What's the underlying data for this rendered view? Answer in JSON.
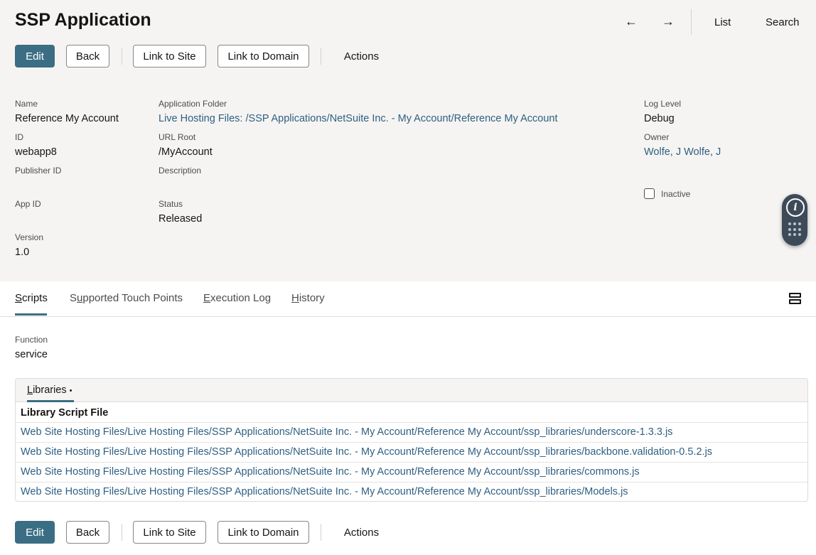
{
  "page": {
    "title": "SSP Application",
    "nav": {
      "back_arrow": "←",
      "forward_arrow": "→",
      "list": "List",
      "search": "Search"
    }
  },
  "toolbar": {
    "edit": "Edit",
    "back": "Back",
    "link_to_site": "Link to Site",
    "link_to_domain": "Link to Domain",
    "actions": "Actions"
  },
  "fields": {
    "name": {
      "label": "Name",
      "value": "Reference My Account"
    },
    "id": {
      "label": "ID",
      "value": "webapp8"
    },
    "publisher_id": {
      "label": "Publisher ID",
      "value": ""
    },
    "app_id": {
      "label": "App ID",
      "value": ""
    },
    "version": {
      "label": "Version",
      "value": "1.0"
    },
    "application_folder": {
      "label": "Application Folder",
      "value": "Live Hosting Files: /SSP Applications/NetSuite Inc. - My Account/Reference My Account"
    },
    "url_root": {
      "label": "URL Root",
      "value": "/MyAccount"
    },
    "description": {
      "label": "Description",
      "value": ""
    },
    "status": {
      "label": "Status",
      "value": "Released"
    },
    "log_level": {
      "label": "Log Level",
      "value": "Debug"
    },
    "owner": {
      "label": "Owner",
      "value": "Wolfe, J Wolfe, J"
    },
    "inactive": {
      "label": "Inactive",
      "checked": false
    }
  },
  "float_panel": {
    "info_icon": "info-icon",
    "glyph": "i",
    "apps_icon": "grid-dots-icon"
  },
  "tabs": [
    {
      "first": "S",
      "rest": "cripts",
      "active": true
    },
    {
      "first": "S",
      "rest": "upported Touch Points",
      "active": false,
      "prefix": "",
      "underline_index": 1
    },
    {
      "first": "E",
      "rest": "xecution Log",
      "active": false
    },
    {
      "first": "H",
      "rest": "istory",
      "active": false
    }
  ],
  "scripts_tab": {
    "function_label": "Function",
    "function_value": "service",
    "sublist": {
      "tab_first": "L",
      "tab_rest": "ibraries",
      "tab_marker": "•",
      "column_header": "Library Script File",
      "rows": [
        "Web Site Hosting Files/Live Hosting Files/SSP Applications/NetSuite Inc. - My Account/Reference My Account/ssp_libraries/underscore-1.3.3.js",
        "Web Site Hosting Files/Live Hosting Files/SSP Applications/NetSuite Inc. - My Account/Reference My Account/ssp_libraries/backbone.validation-0.5.2.js",
        "Web Site Hosting Files/Live Hosting Files/SSP Applications/NetSuite Inc. - My Account/Reference My Account/ssp_libraries/commons.js",
        "Web Site Hosting Files/Live Hosting Files/SSP Applications/NetSuite Inc. - My Account/Reference My Account/ssp_libraries/Models.js"
      ]
    }
  },
  "colors": {
    "primary": "#3b6e84",
    "link": "#2f5f82",
    "header_bg": "#f5f4f2",
    "float_panel": "#3d4b59"
  }
}
